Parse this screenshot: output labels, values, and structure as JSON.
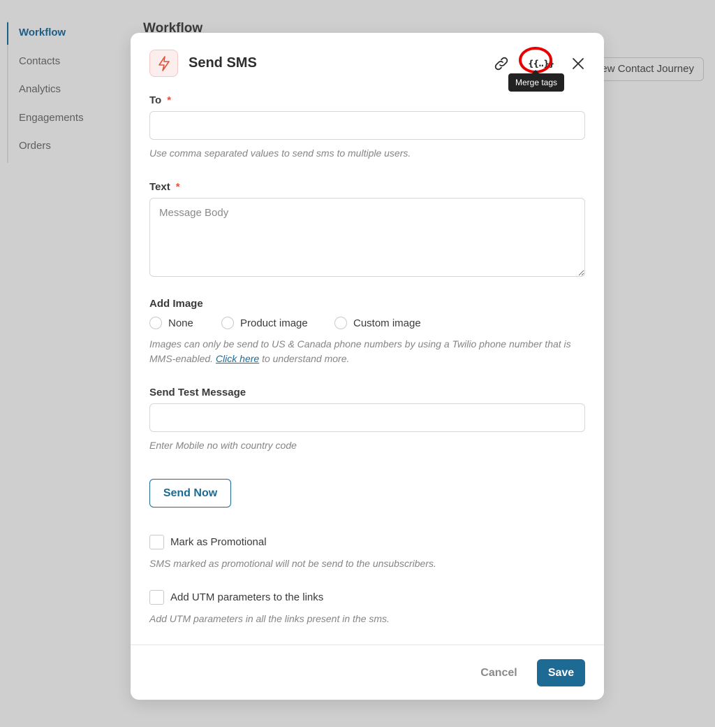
{
  "sidebar": {
    "items": [
      {
        "label": "Workflow",
        "active": true
      },
      {
        "label": "Contacts"
      },
      {
        "label": "Analytics"
      },
      {
        "label": "Engagements"
      },
      {
        "label": "Orders"
      }
    ]
  },
  "background": {
    "page_title": "Workflow",
    "journey_button": "View Contact Journey"
  },
  "modal": {
    "title": "Send SMS",
    "header_icon": "lightning-icon",
    "merge_icon_glyph": "{{..}}",
    "tooltip": "Merge tags",
    "to": {
      "label": "To",
      "required_mark": "*",
      "value": "",
      "help": "Use comma separated values to send sms to multiple users."
    },
    "text": {
      "label": "Text",
      "required_mark": "*",
      "placeholder": "Message Body"
    },
    "add_image": {
      "label": "Add Image",
      "options": [
        "None",
        "Product image",
        "Custom image"
      ],
      "help_before": "Images can only be send to US & Canada phone numbers by using a Twilio phone number that is MMS-enabled.",
      "help_link": "Click here",
      "help_after": "to understand more."
    },
    "test_message": {
      "label": "Send Test Message",
      "value": "",
      "help": "Enter Mobile no with country code",
      "button": "Send Now"
    },
    "promotional": {
      "label": "Mark as Promotional",
      "checked": false,
      "help": "SMS marked as promotional will not be send to the unsubscribers."
    },
    "utm": {
      "label": "Add UTM parameters to the links",
      "checked": false,
      "help": "Add UTM parameters in all the links present in the sms."
    },
    "footer": {
      "cancel": "Cancel",
      "save": "Save"
    }
  },
  "colors": {
    "accent": "#1d6a94",
    "highlight": "#e60000",
    "required": "#e0533d"
  }
}
